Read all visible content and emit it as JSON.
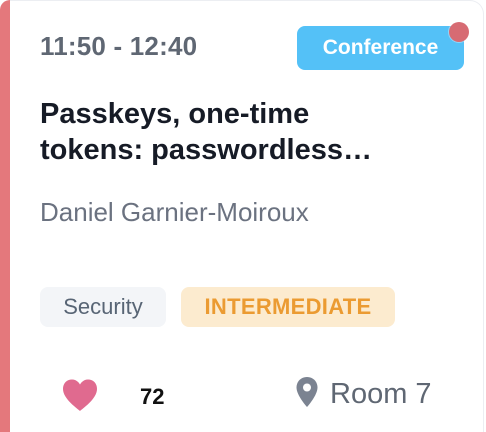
{
  "session": {
    "time": "11:50 - 12:40",
    "type": "Conference",
    "title_lines": [
      "Passkeys, one-time",
      "tokens: passwordless…"
    ],
    "speaker": "Daniel Garnier-Moiroux",
    "tags": {
      "track": "Security",
      "level": "INTERMEDIATE"
    },
    "likes": "72",
    "room": "Room 7"
  },
  "icons": {
    "favorite": "heart-icon",
    "location": "map-pin-icon",
    "live": "status-dot"
  },
  "colors": {
    "accent_bar": "#e4787c",
    "type_badge": "#54c1f7",
    "level_badge_bg": "#fcebcf",
    "level_badge_text": "#eb9b32",
    "heart": "#e06a8f",
    "live_dot": "#d76b73"
  }
}
